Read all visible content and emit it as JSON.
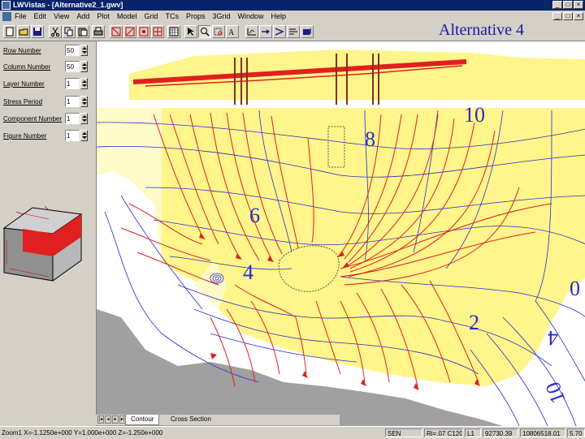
{
  "window": {
    "title": "LWVistas - [Alternative2_1.gwv]"
  },
  "menu": [
    "File",
    "Edit",
    "View",
    "Add",
    "Plot",
    "Model",
    "Grid",
    "TCs",
    "Props",
    "3Grid",
    "Window",
    "Help"
  ],
  "overlay_label": "Alternative 4",
  "fields": [
    {
      "label": "Row Number",
      "value": "50"
    },
    {
      "label": "Column Number",
      "value": "50"
    },
    {
      "label": "Layer Number",
      "value": "1"
    },
    {
      "label": "Stress Period",
      "value": "1"
    },
    {
      "label": "Component Number",
      "value": "1"
    },
    {
      "label": "Figure Number",
      "value": "1"
    }
  ],
  "contour_labels": [
    "10",
    "8",
    "6",
    "4",
    "2",
    "4",
    "10",
    "0"
  ],
  "tabs": [
    "Contour",
    "Cross Section"
  ],
  "status": [
    "Zoom1 X=-1.1250e+000 Y=1.000e+000 Z=-1.250e+000",
    "SEN",
    "Ri=.07 C120",
    "L1",
    "92730.39",
    "10806518.01",
    "5.70"
  ],
  "colors": {
    "red": "#e02020",
    "yellow": "#fff58a",
    "lightyellow": "#fffbc8",
    "gray": "#a0a0a0",
    "contour_blue": "#2a2ad0"
  }
}
